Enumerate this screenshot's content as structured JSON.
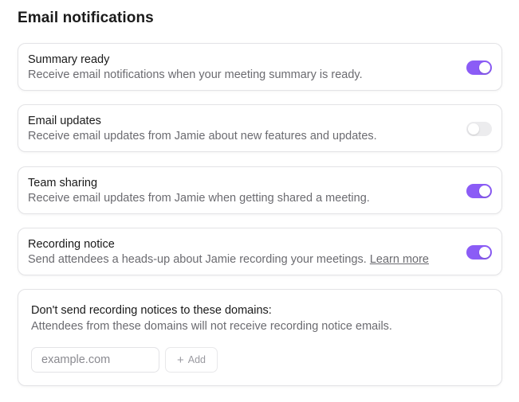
{
  "page": {
    "title": "Email notifications"
  },
  "settings": [
    {
      "title": "Summary ready",
      "description": "Receive email notifications when your meeting summary is ready.",
      "enabled": true
    },
    {
      "title": "Email updates",
      "description": "Receive email updates from Jamie about new features and updates.",
      "enabled": false
    },
    {
      "title": "Team sharing",
      "description": "Receive email updates from Jamie when getting shared a meeting.",
      "enabled": true
    },
    {
      "title": "Recording notice",
      "description": "Send attendees a heads-up about Jamie recording your meetings.",
      "link_text": "Learn more",
      "enabled": true
    }
  ],
  "domains": {
    "title": "Don't send recording notices to these domains:",
    "description": "Attendees from these domains will not receive recording notice emails.",
    "input_value": "",
    "input_placeholder": "example.com",
    "add_icon": "+",
    "add_label": "Add"
  },
  "colors": {
    "toggle_on": "#8b5cf6",
    "toggle_off": "#ececee"
  }
}
